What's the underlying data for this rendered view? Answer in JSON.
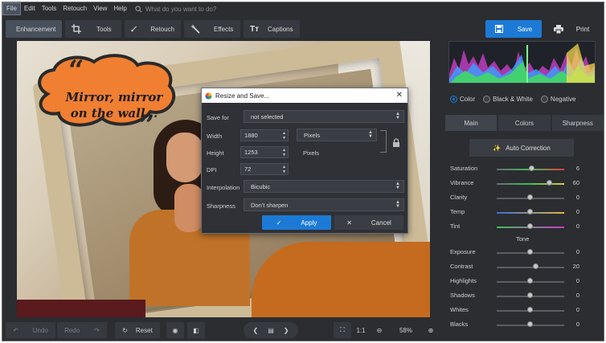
{
  "menu": {
    "items": [
      "File",
      "Edit",
      "Tools",
      "Retouch",
      "View",
      "Help"
    ],
    "search_placeholder": "What do you want to do?"
  },
  "toolbar": {
    "tabs": [
      "Enhancement",
      "Tools",
      "Retouch",
      "Effects",
      "Captions"
    ],
    "save_label": "Save",
    "print_label": "Print"
  },
  "caption": {
    "line1": "Mirror, mirror",
    "line2": "on the wall..."
  },
  "dialog": {
    "title": "Resize and Save...",
    "save_for_label": "Save for",
    "save_for_value": "not selected",
    "width_label": "Width",
    "width_value": "1880",
    "height_label": "Height",
    "height_value": "1253",
    "dpi_label": "DPI",
    "dpi_value": "72",
    "units_value": "Pixels",
    "units_static": "Pixels",
    "interpolation_label": "Interpolation",
    "interpolation_value": "Bicubic",
    "sharpness_label": "Sharpness",
    "sharpness_value": "Don't sharpen",
    "apply_label": "Apply",
    "cancel_label": "Cancel"
  },
  "bottom": {
    "undo_label": "Undo",
    "redo_label": "Redo",
    "reset_label": "Reset",
    "ratio_label": "1:1",
    "zoom_value": "58%"
  },
  "panel": {
    "modes": [
      "Color",
      "Black & White",
      "Negative"
    ],
    "selected_mode": "Color",
    "tabs": [
      "Main",
      "Colors",
      "Sharpness"
    ],
    "auto_label": "Auto Correction",
    "tone_label": "Tone",
    "sliders_top": [
      {
        "label": "Saturation",
        "value": "6",
        "level": 0.52
      },
      {
        "label": "Vibrance",
        "value": "60",
        "level": 0.78
      },
      {
        "label": "Clarity",
        "value": "0",
        "level": 0.5
      },
      {
        "label": "Temp",
        "value": "0",
        "level": 0.5
      },
      {
        "label": "Tint",
        "value": "0",
        "level": 0.5
      }
    ],
    "sliders_tone": [
      {
        "label": "Exposure",
        "value": "0",
        "level": 0.5
      },
      {
        "label": "Contrast",
        "value": "20",
        "level": 0.58
      },
      {
        "label": "Highlights",
        "value": "0",
        "level": 0.5
      },
      {
        "label": "Shadows",
        "value": "0",
        "level": 0.5
      },
      {
        "label": "Whites",
        "value": "0",
        "level": 0.5
      },
      {
        "label": "Blacks",
        "value": "0",
        "level": 0.5
      }
    ]
  },
  "colors": {
    "accent": "#1c7ad6",
    "bubble": "#f07f32"
  }
}
